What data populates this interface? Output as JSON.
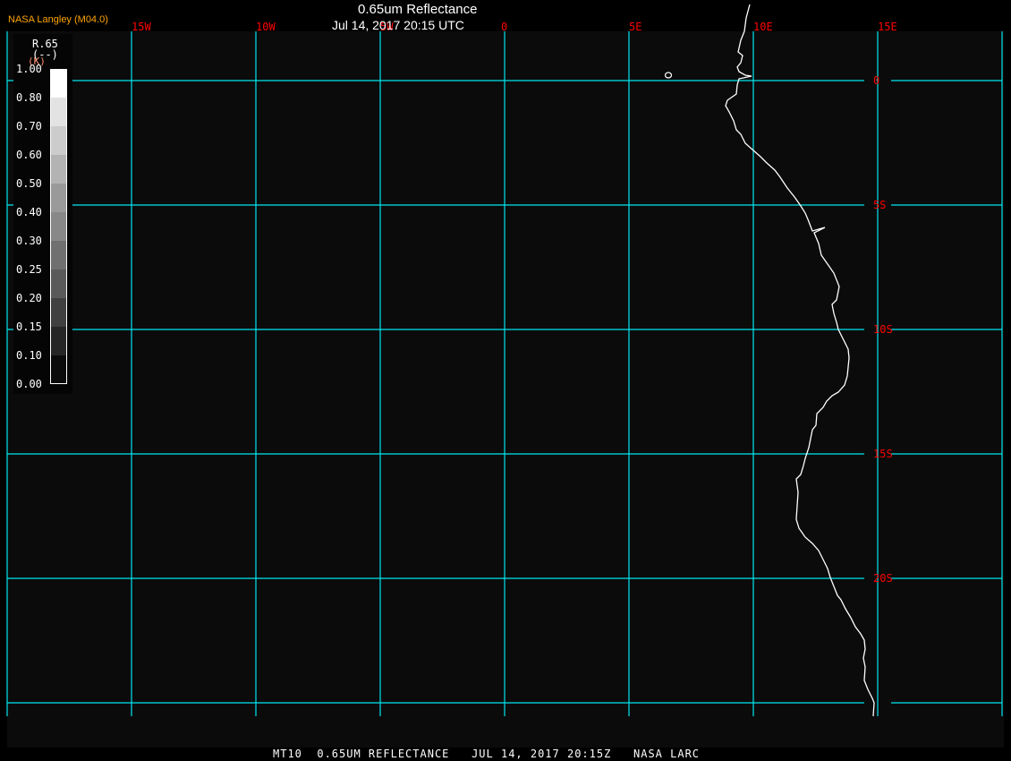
{
  "header": {
    "brand": "NASA Langley (M04.0)",
    "title": "0.65um Reflectance",
    "datetime": "Jul 14, 2017 20:15 UTC"
  },
  "footer": {
    "text": "MT10  0.65UM REFLECTANCE   JUL 14, 2017 20:15Z   NASA LARC"
  },
  "legend": {
    "variable": "R.65",
    "units": "(--)",
    "unit_overlay": "(K)",
    "labels": [
      "1.00",
      "0.80",
      "0.70",
      "0.60",
      "0.50",
      "0.40",
      "0.30",
      "0.25",
      "0.20",
      "0.15",
      "0.10",
      "0.00"
    ],
    "colors": [
      "#ffffff",
      "#e3e3e3",
      "#cccccc",
      "#b3b3b3",
      "#9a9a9a",
      "#888888",
      "#707070",
      "#5a5a5a",
      "#404040",
      "#262626",
      "#0b0b0b"
    ]
  },
  "map": {
    "longitude_labels": [
      "15W",
      "10W",
      "5W",
      "0",
      "5E",
      "10E",
      "15E"
    ],
    "latitude_labels": [
      "0",
      "5S",
      "10S",
      "15S",
      "20S"
    ],
    "colors": {
      "background": "#0b0b0b",
      "grid": "#00e5ee",
      "grid_label": "#ff0000",
      "coastline": "#ffffff"
    }
  }
}
